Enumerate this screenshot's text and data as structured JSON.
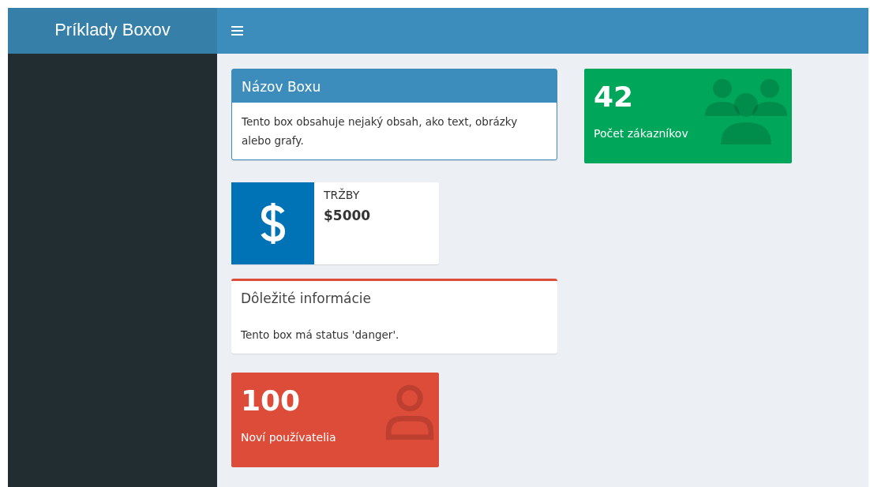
{
  "header": {
    "title": "Príklady Boxov"
  },
  "rows": [
    [
      {
        "kind": "box",
        "title": "Názov Boxu",
        "color": "#3c8dbc",
        "solid_header": true,
        "body": "Tento box obsahuje nejaký obsah, ako text, obrázky alebo grafy."
      },
      {
        "kind": "value_box",
        "value": "42",
        "subtitle": "Počet zákazníkov",
        "color": "#00a65a"
      }
    ],
    [
      {
        "kind": "info_box",
        "title": "TRŽBY",
        "value": "$5000",
        "color": "#0073b7"
      }
    ],
    [
      {
        "kind": "box",
        "title": "Dôležité informácie",
        "color": "#dd4b39",
        "solid_header": false,
        "body": "Tento box má status 'danger'."
      }
    ],
    [
      {
        "kind": "value_box",
        "value": "100",
        "subtitle": "Noví používatelia",
        "color": "#dd4b39"
      }
    ]
  ]
}
